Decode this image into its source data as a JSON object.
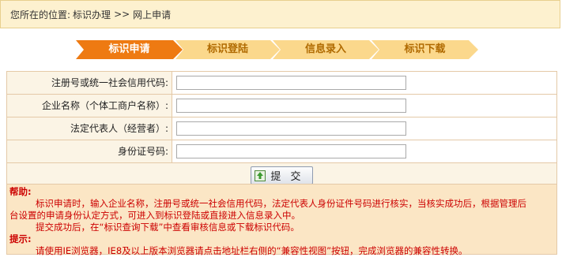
{
  "breadcrumb": {
    "prefix": "您所在的位置:",
    "item1": "标识办理",
    "separator": ">>",
    "item2": "网上申请"
  },
  "steps": [
    {
      "label": "标识申请",
      "active": true
    },
    {
      "label": "标识登陆",
      "active": false
    },
    {
      "label": "信息录入",
      "active": false
    },
    {
      "label": "标识下载",
      "active": false
    }
  ],
  "colors": {
    "step_active_bg": "#ee7a12",
    "step_inactive_bg": "#fbd88c",
    "step_active_text": "#ffffff",
    "step_inactive_text": "#b06a00",
    "help_text": "#cc0000"
  },
  "form": {
    "fields": [
      {
        "label": "注册号或统一社会信用代码:",
        "value": ""
      },
      {
        "label": "企业名称（个体工商户名称）:",
        "value": ""
      },
      {
        "label": "法定代表人（经营者）:",
        "value": ""
      },
      {
        "label": "身份证号码:",
        "value": ""
      }
    ],
    "submit_label": "提 交",
    "submit_icon": "submit-icon"
  },
  "help": {
    "help_title": "帮助:",
    "help_line1": "标识申请时，输入企业名称，注册号或统一社会信用代码，法定代表人身份证件号码进行核实，当核实成功后，根据管理后",
    "help_line2": "台设置的申请身份认定方式，可进入到标识登陆或直接进入信息录入中。",
    "help_line3": "提交成功后，在“标识查询下载”中查看审核信息或下载标识代码。",
    "tip_title": "提示:",
    "tip_line1": "请使用IE浏览器，IE8及以上版本浏览器请点击地址栏右侧的“兼容性视图”按钮，完成浏览器的兼容性转换。"
  }
}
